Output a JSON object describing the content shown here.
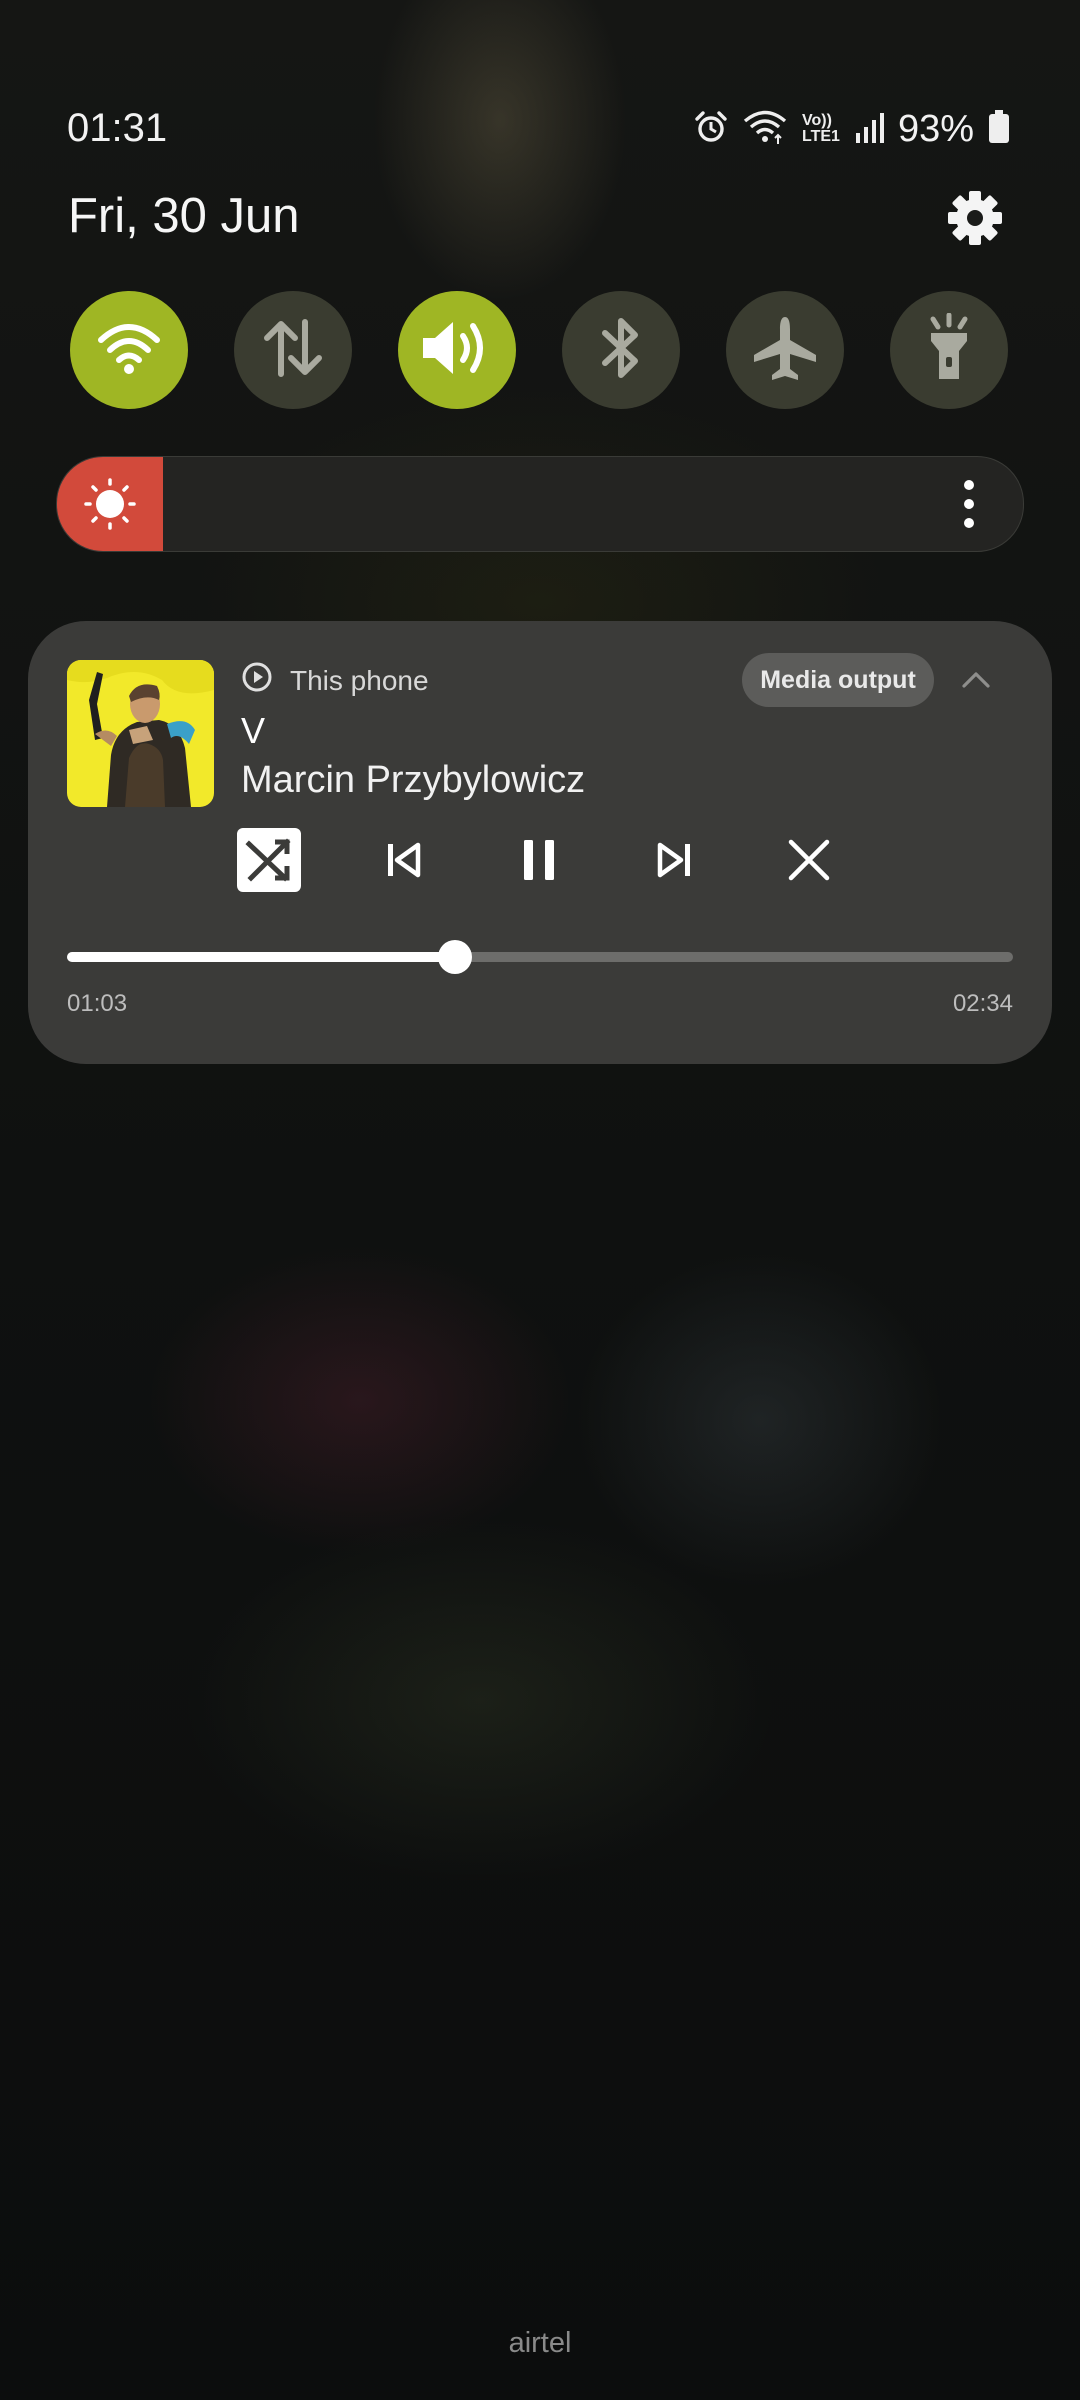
{
  "status_bar": {
    "time": "01:31",
    "battery": "93%",
    "network_top": "Vo))",
    "network_bottom": "LTE1"
  },
  "date": "Fri, 30 Jun",
  "quick_tiles": [
    {
      "name": "wifi",
      "icon": "wifi-icon",
      "state": "on"
    },
    {
      "name": "mobile-data",
      "icon": "data-arrows-icon",
      "state": "off"
    },
    {
      "name": "sound",
      "icon": "speaker-icon",
      "state": "on"
    },
    {
      "name": "bluetooth",
      "icon": "bluetooth-icon",
      "state": "off"
    },
    {
      "name": "airplane",
      "icon": "airplane-icon",
      "state": "off"
    },
    {
      "name": "flashlight",
      "icon": "flashlight-icon",
      "state": "off"
    }
  ],
  "colors": {
    "tile_on": "#9fb624",
    "tile_off": "#3a3c30",
    "brightness_fill": "#d24a3b",
    "card_bg": "#3b3b39"
  },
  "brightness": {
    "level": 0.11
  },
  "media": {
    "output_device": "This phone",
    "output_button": "Media output",
    "title": "V",
    "artist": "Marcin Przybylowicz",
    "elapsed": "01:03",
    "duration": "02:34",
    "progress": 0.41,
    "shuffle_on": true
  },
  "carrier": "airtel"
}
